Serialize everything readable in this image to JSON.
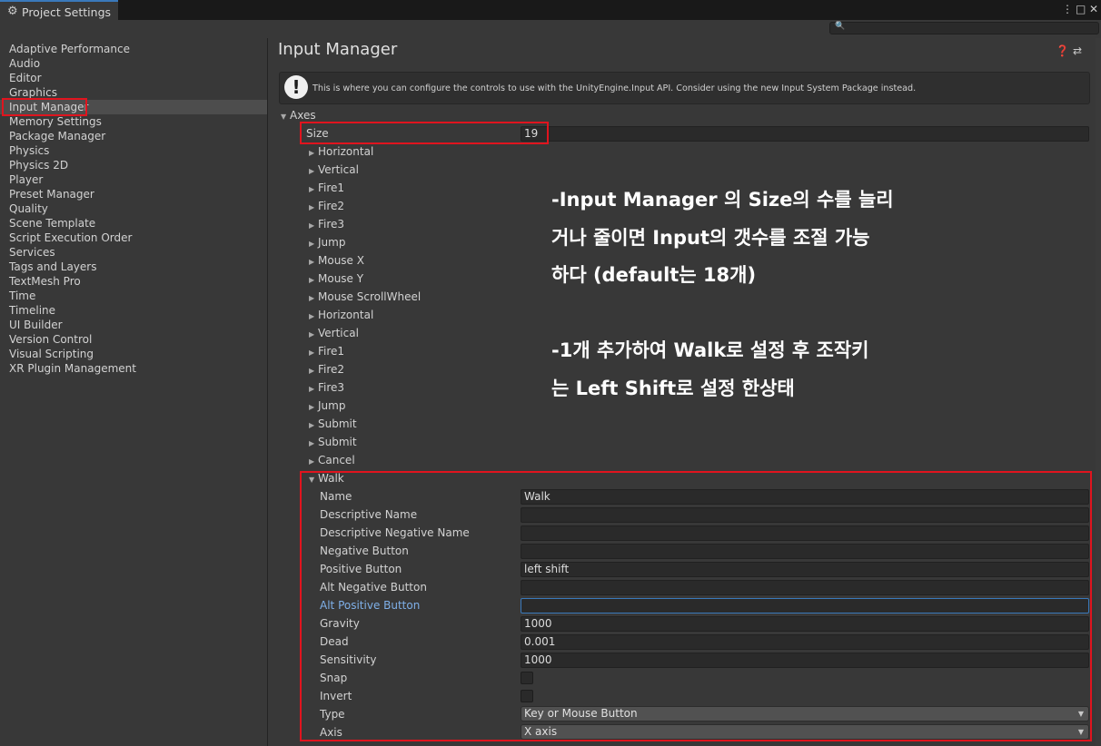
{
  "window": {
    "tab_title": "Project Settings",
    "tab_icon": "gear-icon",
    "menu_icon": "⋮",
    "maximize_icon": "□",
    "close_icon": "✕",
    "search_placeholder": ""
  },
  "sidebar": {
    "selected": "Input Manager",
    "items": [
      "Adaptive Performance",
      "Audio",
      "Editor",
      "Graphics",
      "Input Manager",
      "Memory Settings",
      "Package Manager",
      "Physics",
      "Physics 2D",
      "Player",
      "Preset Manager",
      "Quality",
      "Scene Template",
      "Script Execution Order",
      "Services",
      "Tags and Layers",
      "TextMesh Pro",
      "Time",
      "Timeline",
      "UI Builder",
      "Version Control",
      "Visual Scripting",
      "XR Plugin Management"
    ]
  },
  "main": {
    "title": "Input Manager",
    "help_text": "This is where you can configure the controls to use with the UnityEngine.Input API. Consider using the new Input System Package instead.",
    "axes_label": "Axes",
    "size_label": "Size",
    "size_value": "19",
    "axes": [
      "Horizontal",
      "Vertical",
      "Fire1",
      "Fire2",
      "Fire3",
      "Jump",
      "Mouse X",
      "Mouse Y",
      "Mouse ScrollWheel",
      "Horizontal",
      "Vertical",
      "Fire1",
      "Fire2",
      "Fire3",
      "Jump",
      "Submit",
      "Submit",
      "Cancel"
    ],
    "expanded_axis": "Walk",
    "walk": {
      "name_label": "Name",
      "name_value": "Walk",
      "descriptive_name_label": "Descriptive Name",
      "descriptive_name_value": "",
      "descriptive_negative_name_label": "Descriptive Negative Name",
      "descriptive_negative_name_value": "",
      "negative_button_label": "Negative Button",
      "negative_button_value": "",
      "positive_button_label": "Positive Button",
      "positive_button_value": "left shift",
      "alt_negative_button_label": "Alt Negative Button",
      "alt_negative_button_value": "",
      "alt_positive_button_label": "Alt Positive Button",
      "alt_positive_button_value": "",
      "gravity_label": "Gravity",
      "gravity_value": "1000",
      "dead_label": "Dead",
      "dead_value": "0.001",
      "sensitivity_label": "Sensitivity",
      "sensitivity_value": "1000",
      "snap_label": "Snap",
      "snap_checked": false,
      "invert_label": "Invert",
      "invert_checked": false,
      "type_label": "Type",
      "type_value": "Key or Mouse Button",
      "axis_label": "Axis",
      "axis_value": "X axis"
    }
  },
  "annotation": {
    "lines": [
      "-Input Manager 의 Size의 수를 늘리",
      "거나 줄이면 Input의 갯수를 조절 가능",
      "하다 (default는 18개)",
      "",
      "-1개 추가하여 Walk로 설정 후 조작키",
      "는 Left Shift로 설정 한상태"
    ]
  },
  "colors": {
    "highlight_box": "#e0141e",
    "focus_blue": "#3a79bb",
    "panel_bg": "#383838"
  }
}
